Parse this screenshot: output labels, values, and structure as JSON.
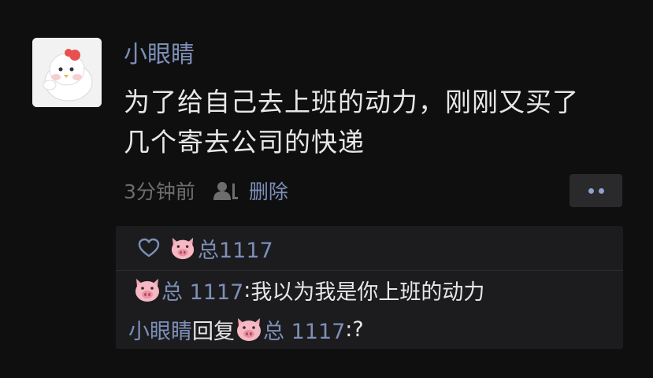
{
  "post": {
    "nickname": "小眼睛",
    "text_line_1": "为了给自己去上班的动力，刚刚又买了",
    "text_line_2": "几个寄去公司的快递",
    "time": "3分钟前",
    "delete_label": "删除",
    "avatar_icon": "chick-avatar",
    "privacy_icon": "partial-visibility-icon",
    "more_icon": "more-dots-icon"
  },
  "likes": {
    "heart_icon": "heart-outline-icon",
    "name": "总1117"
  },
  "comments": [
    {
      "author": "总 1117",
      "separator": ":",
      "text": " 我以为我是你上班的动力"
    },
    {
      "author": "小眼睛",
      "reply_word": "回复",
      "reply_to": "总 1117",
      "separator": ":",
      "text": " ?"
    }
  ],
  "colors": {
    "background": "#0f0f10",
    "panel": "#1c1c1e",
    "link_blue": "#7d8fb8",
    "text": "#e7e7e7",
    "muted": "#6d6d6d"
  }
}
